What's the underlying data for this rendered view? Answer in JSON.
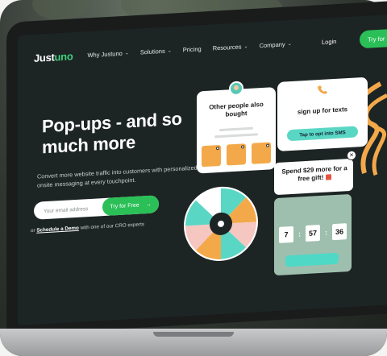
{
  "nav": {
    "logo_main": "Just",
    "logo_accent": "uno",
    "items": [
      {
        "label": "Why Justuno",
        "dropdown": true
      },
      {
        "label": "Solutions",
        "dropdown": true
      },
      {
        "label": "Pricing",
        "dropdown": false
      },
      {
        "label": "Resources",
        "dropdown": true
      },
      {
        "label": "Company",
        "dropdown": true
      }
    ],
    "chevron": "⌄",
    "login_label": "Login",
    "cta_label": "Try for Free",
    "cta_arrow": "→"
  },
  "hero": {
    "title": "Pop-ups - and so much more",
    "subtitle": "Convert more website traffic into customers with personalized onsite messaging at every touchpoint.",
    "email_placeholder": "Your email address",
    "cta_label": "Try for Free",
    "cta_arrow": "→",
    "schedule_prefix": "or",
    "schedule_link": "Schedule a Demo",
    "schedule_suffix": "with one of our CRO experts"
  },
  "cards": {
    "people_title": "Other people also bought",
    "texts_title": "sign up for texts",
    "texts_button": "Tap to opt into SMS",
    "gift_text": "Spend $29 more for a free gift!",
    "close_glyph": "✕",
    "timer_digits": [
      "7",
      "57",
      "36"
    ],
    "timer_separator": ":"
  },
  "colors": {
    "screen_bg": "#1d2424",
    "accent_green": "#2bbf57",
    "teal": "#5ad7c4",
    "orange": "#f3a94a"
  },
  "icons": {
    "phone": "phone-icon",
    "gift": "gift-icon",
    "close": "close-icon",
    "arrow": "arrow-right-icon"
  }
}
